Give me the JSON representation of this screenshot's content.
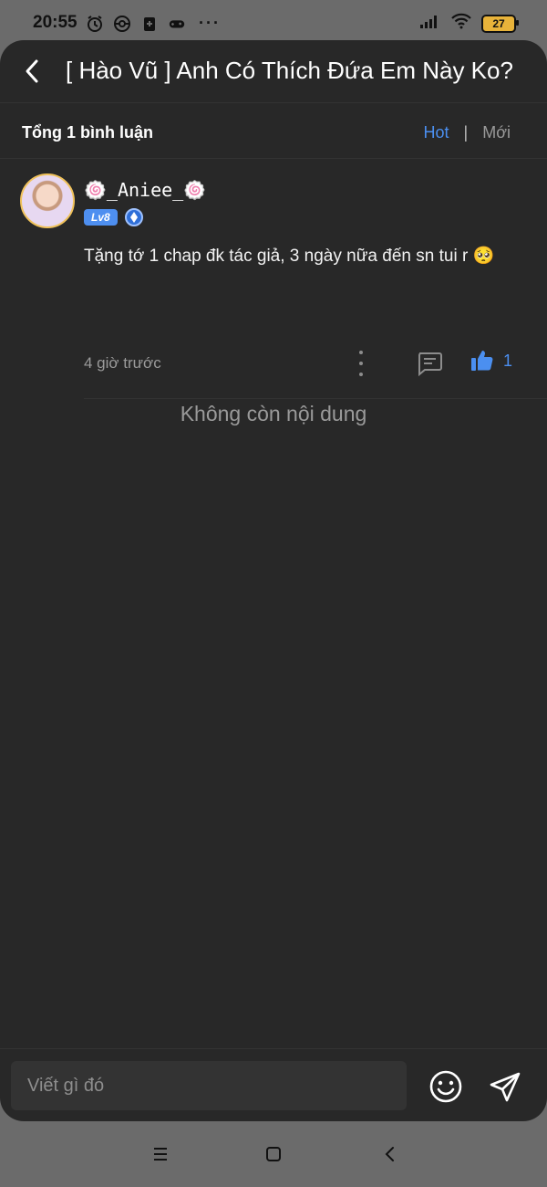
{
  "status_bar": {
    "time": "20:55",
    "battery": "27",
    "left_icons": [
      "alarm-icon",
      "pokeball-icon",
      "clipboard-icon",
      "gamepad-icon"
    ],
    "more": "···"
  },
  "header": {
    "title": "[ Hào Vũ ] Anh Có Thích Đứa Em Này Ko?"
  },
  "comments_bar": {
    "count_label": "Tổng 1 bình luận",
    "sort_hot": "Hot",
    "sort_separator": "|",
    "sort_new": "Mới",
    "accent_color": "#4b8ff0"
  },
  "comments": [
    {
      "username": "🍥_Aniee_🍥",
      "level": "Lv8",
      "text": "Tặng tớ 1 chap đk tác giả, 3 ngày nữa đến sn tui r 🥺",
      "time": "4 giờ trước",
      "likes": "1"
    }
  ],
  "empty_message": "Không còn nội dung",
  "input": {
    "placeholder": "Viết gì đó"
  }
}
